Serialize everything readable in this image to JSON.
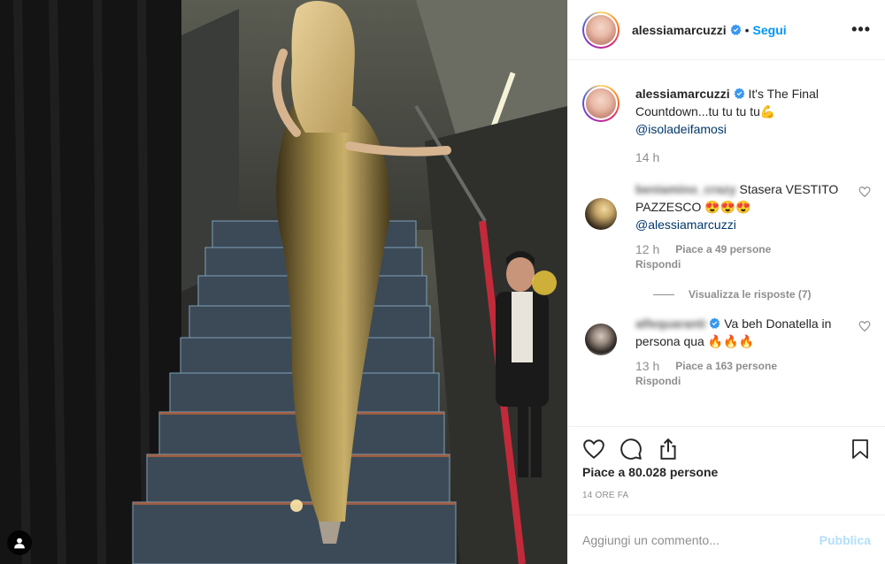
{
  "post": {
    "username": "alessiamarcuzzi",
    "follow_label": "Segui",
    "dot": "•",
    "more_label": "•••"
  },
  "caption": {
    "username": "alessiamarcuzzi",
    "text": "It's The Final Countdown...tu tu tu tu💪",
    "mention": "@isoladeifamosi",
    "time": "14 h"
  },
  "comments": [
    {
      "username": "beniamino_crazy",
      "text": "Stasera VESTITO PAZZESCO 😍😍😍",
      "mention": "@alessiamarcuzzi",
      "time": "12 h",
      "likes": "Piace a 49 persone",
      "reply": "Rispondi",
      "view_replies": "Visualizza le risposte (7)"
    },
    {
      "username": "alfequaranti",
      "text": "Va beh Donatella in persona qua 🔥🔥🔥",
      "time": "13 h",
      "likes": "Piace a 163 persone",
      "reply": "Rispondi"
    }
  ],
  "stats": {
    "likes": "Piace a 80.028 persone",
    "age": "14 ORE FA"
  },
  "composer": {
    "placeholder": "Aggiungi un commento...",
    "publish_label": "Pubblica"
  },
  "colors": {
    "link_blue": "#0095f6",
    "mention": "#00376b",
    "muted": "#8e8e8e",
    "publish_disabled": "#b2dffc"
  },
  "icons": [
    "user-tag-icon",
    "verified-icon",
    "more-icon",
    "heart-icon",
    "comment-icon",
    "share-icon",
    "bookmark-icon"
  ]
}
